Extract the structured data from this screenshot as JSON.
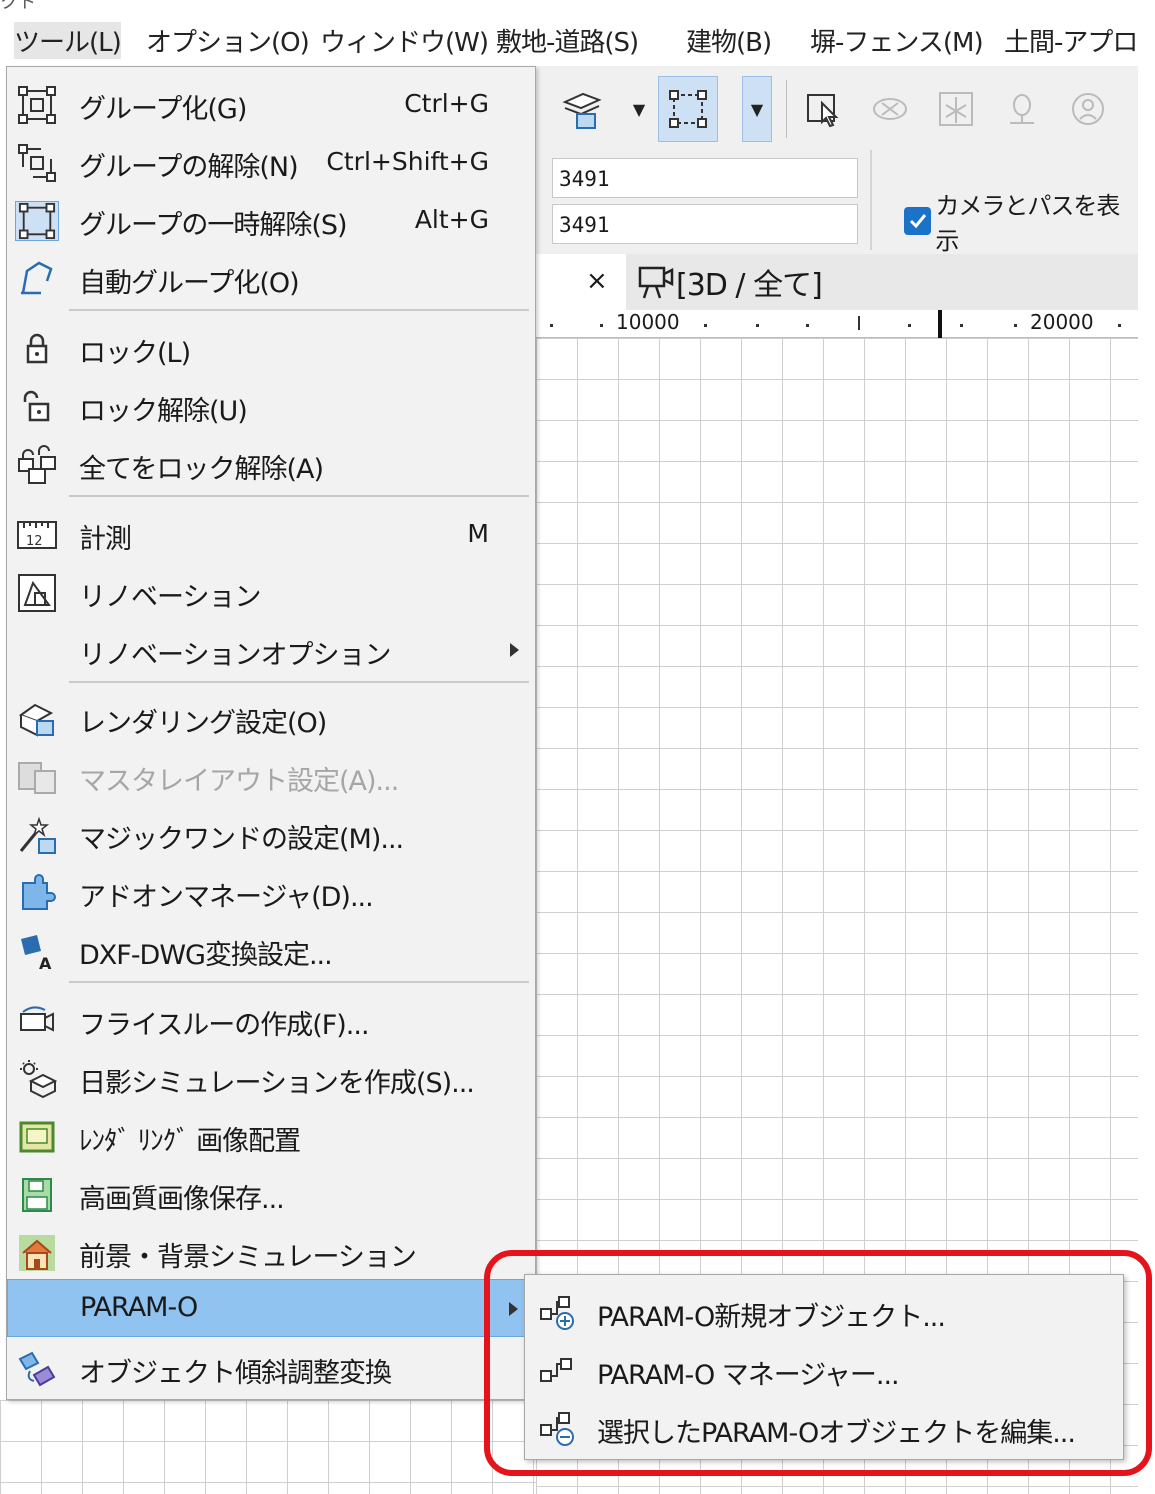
{
  "menubar": {
    "crumb": "クト",
    "items": [
      {
        "label": "ツール(L)"
      },
      {
        "label": "オプション(O)"
      },
      {
        "label": "ウィンドウ(W)"
      },
      {
        "label": "敷地-道路(S)"
      },
      {
        "label": "建物(B)"
      },
      {
        "label": "塀-フェンス(M)"
      },
      {
        "label": "土間-アプロ"
      }
    ]
  },
  "info": {
    "field1": "3491",
    "field2": "3491",
    "checkbox_label": "カメラとパスを表示",
    "checkbox_checked": true
  },
  "tab": {
    "close": "×",
    "title": "[3D / 全て]"
  },
  "ruler": {
    "label1": "10000",
    "label2": "20000"
  },
  "left_edge": "20000",
  "menu": {
    "items": [
      {
        "label": "グループ化(G)",
        "shortcut": "Ctrl+G",
        "icon": "group-icon"
      },
      {
        "label": "グループの解除(N)",
        "shortcut": "Ctrl+Shift+G",
        "icon": "ungroup-icon"
      },
      {
        "label": "グループの一時解除(S)",
        "shortcut": "Alt+G",
        "icon": "suspend-group-icon"
      },
      {
        "label": "自動グループ化(O)",
        "shortcut": "",
        "icon": "auto-group-icon"
      },
      {
        "label": "ロック(L)",
        "shortcut": "",
        "icon": "lock-icon"
      },
      {
        "label": "ロック解除(U)",
        "shortcut": "",
        "icon": "unlock-icon"
      },
      {
        "label": "全てをロック解除(A)",
        "shortcut": "",
        "icon": "unlock-all-icon"
      },
      {
        "label": "計測",
        "shortcut": "M",
        "icon": "ruler-icon"
      },
      {
        "label": "リノベーション",
        "shortcut": "",
        "icon": "renovation-icon"
      },
      {
        "label": "リノベーションオプション",
        "shortcut": "",
        "icon": ""
      },
      {
        "label": "レンダリング設定(O)",
        "shortcut": "",
        "icon": "rendering-settings-icon"
      },
      {
        "label": "マスタレイアウト設定(A)...",
        "shortcut": "",
        "icon": "master-layout-icon"
      },
      {
        "label": "マジックワンドの設定(M)...",
        "shortcut": "",
        "icon": "magic-wand-icon"
      },
      {
        "label": "アドオンマネージャ(D)...",
        "shortcut": "",
        "icon": "addon-manager-icon"
      },
      {
        "label": "DXF-DWG変換設定...",
        "shortcut": "",
        "icon": "dxf-dwg-icon"
      },
      {
        "label": "フライスルーの作成(F)...",
        "shortcut": "",
        "icon": "camera-icon"
      },
      {
        "label": "日影シミュレーションを作成(S)...",
        "shortcut": "",
        "icon": "sun-shadow-icon"
      },
      {
        "label": "ﾚﾝﾀﾞ ﾘﾝｸﾞ 画像配置",
        "shortcut": "",
        "icon": "image-place-icon"
      },
      {
        "label": "高画質画像保存...",
        "shortcut": "",
        "icon": "save-image-icon"
      },
      {
        "label": "前景・背景シミュレーション",
        "shortcut": "",
        "icon": "house-icon"
      },
      {
        "label": "PARAM-O",
        "shortcut": "",
        "icon": ""
      },
      {
        "label": "オブジェクト傾斜調整変換",
        "shortcut": "",
        "icon": "tilt-icon"
      }
    ]
  },
  "submenu": {
    "items": [
      {
        "label": "PARAM-O新規オブジェクト...",
        "icon": "param-o-new-icon"
      },
      {
        "label": "PARAM-O マネージャー...",
        "icon": "param-o-manager-icon"
      },
      {
        "label": "選択したPARAM-Oオブジェクトを編集...",
        "icon": "param-o-edit-icon"
      }
    ]
  },
  "colors": {
    "highlight": "#91c3f1",
    "callout": "#e5141c",
    "checkbox": "#1a73c9"
  }
}
